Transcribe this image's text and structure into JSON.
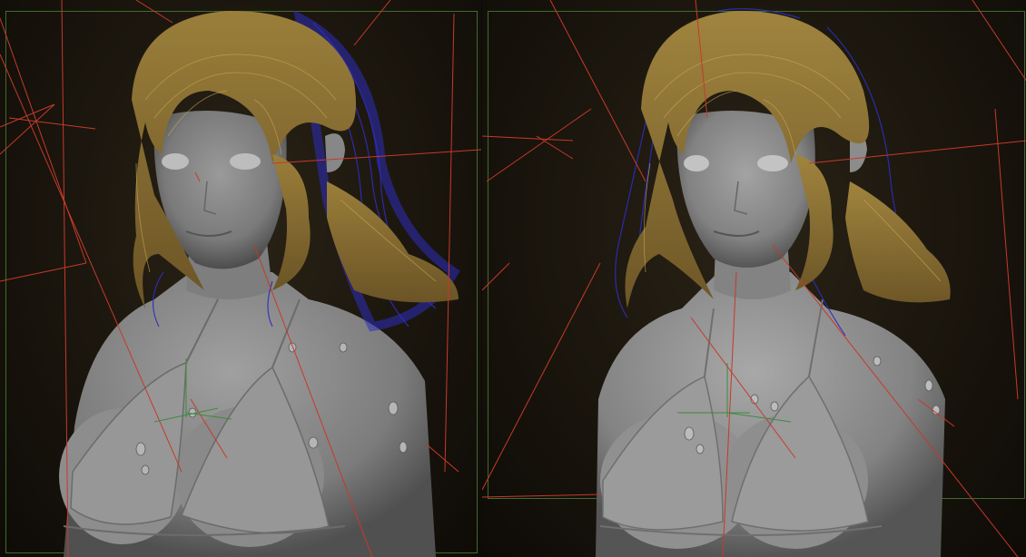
{
  "viewports": [
    {
      "name": "perspective-left",
      "hair_color": "#8a7233",
      "guide_color": "#2d2dbd"
    },
    {
      "name": "perspective-right",
      "hair_color": "#8f7636",
      "guide_color": "#2d2dbd"
    }
  ],
  "colors": {
    "background": "#1a150d",
    "skin": "#8a8a8a",
    "skin_shadow": "#5a5a5a",
    "selection_lines": "#c53a2a",
    "bounding_frame": "#3d6b2e",
    "gizmo": "#3f8a3f"
  }
}
